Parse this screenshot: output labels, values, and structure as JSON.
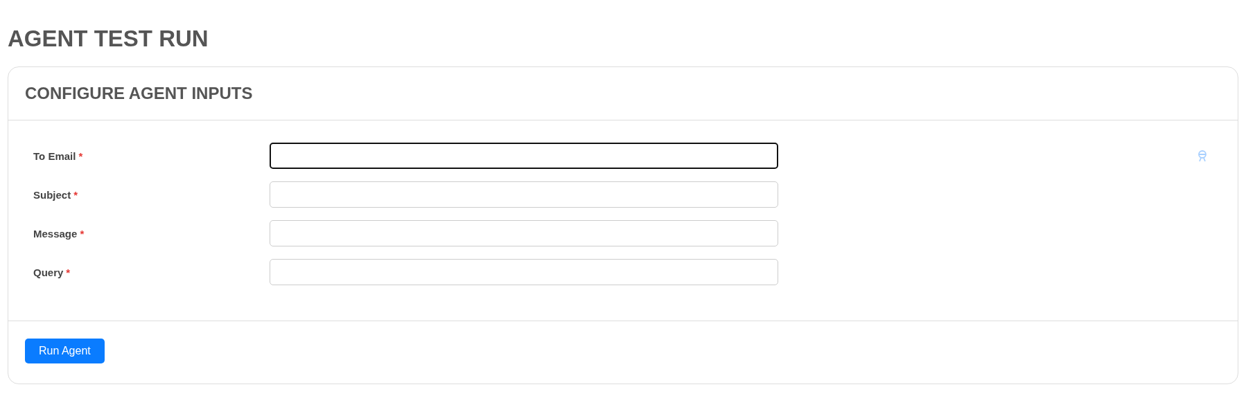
{
  "page_title": "AGENT TEST RUN",
  "card": {
    "title": "CONFIGURE AGENT INPUTS",
    "fields": [
      {
        "label": "To Email",
        "required_mark": "*",
        "focused": true
      },
      {
        "label": "Subject",
        "required_mark": "*",
        "focused": false
      },
      {
        "label": "Message",
        "required_mark": "*",
        "focused": false
      },
      {
        "label": "Query",
        "required_mark": "*",
        "focused": false
      }
    ],
    "button": "Run Agent"
  }
}
